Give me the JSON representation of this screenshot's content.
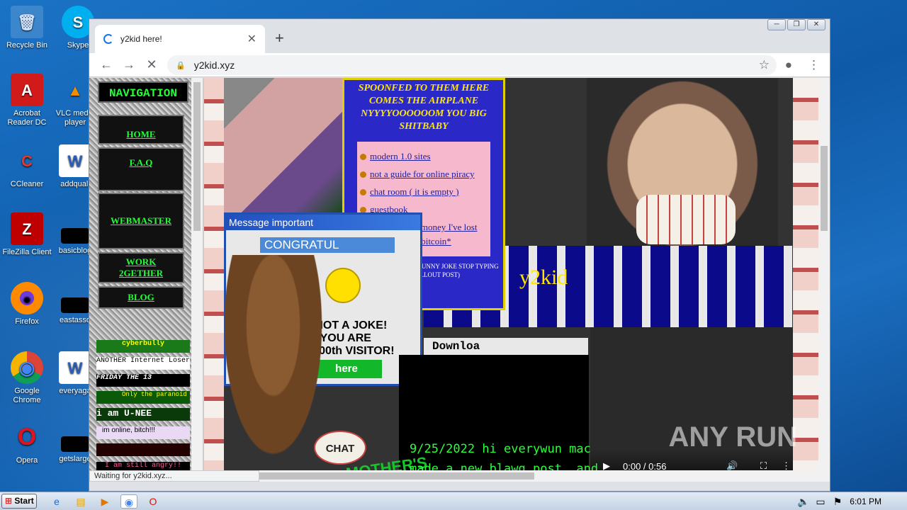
{
  "desktop": {
    "icons": [
      {
        "label": "Recycle Bin",
        "glyph": "🗑"
      },
      {
        "label": "Skype",
        "glyph": "S"
      },
      {
        "label": "Acrobat Reader DC",
        "glyph": "A"
      },
      {
        "label": "VLC media player",
        "glyph": "▲"
      },
      {
        "label": "CCleaner",
        "glyph": "C"
      },
      {
        "label": "addquali",
        "glyph": "W"
      },
      {
        "label": "FileZilla Client",
        "glyph": "Z"
      },
      {
        "label": "basicblog",
        "glyph": ""
      },
      {
        "label": "Firefox",
        "glyph": "●"
      },
      {
        "label": "eastasso",
        "glyph": ""
      },
      {
        "label": "Google Chrome",
        "glyph": "◉"
      },
      {
        "label": "everyaga",
        "glyph": "W"
      },
      {
        "label": "Opera",
        "glyph": "O"
      },
      {
        "label": "getslarge",
        "glyph": ""
      }
    ]
  },
  "browser": {
    "tab_title": "y2kid here!",
    "url": "y2kid.xyz",
    "status_text": "Waiting for y2kid.xyz..."
  },
  "nav": {
    "title": "NAVIGATION",
    "home": "HOME",
    "faq": "F.A.Q",
    "webmaster": "WEBMASTER",
    "work_line1": "WORK",
    "work_line2": "2GETHER",
    "blog": "BLOG",
    "badges": [
      "cyberbully",
      "ANOTHER Internet Loser",
      "FRIDAY THE 13",
      "Only the paranoid surviv",
      "i am U-NEE",
      "im online, bitch!!!",
      "",
      "I am still angry!!"
    ]
  },
  "airplane": {
    "header": "SPOONFED TO THEM HERE COMES THE AIRPLANE NYYYYOOOOOOM YOU BIG SHITBABY",
    "links": [
      "modern 1.0 sites",
      "not a guide for online piracy",
      "chat room ( it is empty )",
      "guestbook",
      "give me your money I've lost everything to bitcoin*"
    ],
    "disclaimer": "*(DISCLAIMER: JUST A FUNNY JOKE STOP TYPING UP THE CALLOUT POST)"
  },
  "message": {
    "title": "Message important",
    "congrats": "CONGRATUL",
    "joke_line1": "S NOT A JOKE!",
    "joke_line2": "YOU ARE",
    "joke_line3": "00.000th VISITOR!",
    "button": "here"
  },
  "collage": {
    "y2kid": "y2kid",
    "download": "Downloa",
    "chat": "CHAT",
    "blog_line1": "9/25/2022 hi everywun mac",
    "blog_line2": "made a new blawg post, and",
    "mother": "MOTHER'S",
    "video_time": "0:00 / 0:56",
    "watermark": "ANY RUN"
  },
  "taskbar": {
    "start_label": "Start",
    "clock": "6:01 PM"
  }
}
